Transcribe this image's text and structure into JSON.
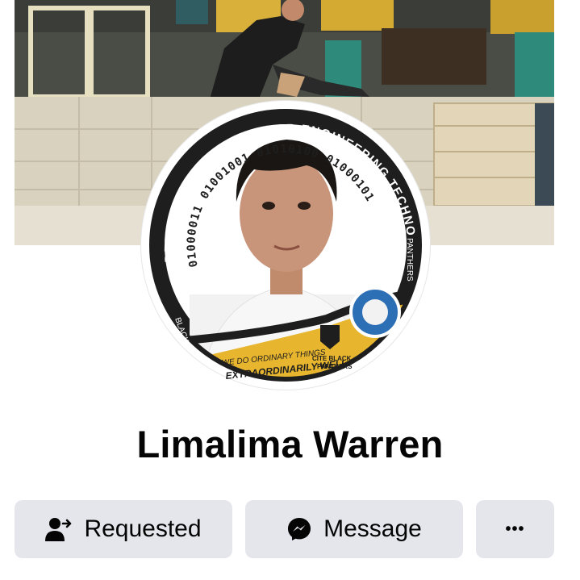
{
  "profile": {
    "name": "Limalima Warren"
  },
  "frame": {
    "arc_text": "DEPARTMENT OF COMPUTER ENGINEERING TECHNOLOGY",
    "binary_text": "01000011 01001001 01010100 01000101",
    "side_left": "BLACK",
    "side_right": "PANTHERS",
    "motto_1": "WE DO ORDINARY THINGS",
    "motto_2": "EXTRAORDINARILY WELL",
    "team_1": "CITE BLACK",
    "team_2": "PANTHERS",
    "colors": {
      "gold": "#e7b52e",
      "dark": "#222222",
      "seal": "#2d6fb5"
    }
  },
  "actions": {
    "requested_label": "Requested",
    "message_label": "Message",
    "more_label": "•••"
  },
  "icons": {
    "requested": "person-requested-icon",
    "message": "messenger-icon",
    "more": "more-dots-icon"
  },
  "colors": {
    "button_bg": "#e4e6eb",
    "text": "#050505"
  }
}
